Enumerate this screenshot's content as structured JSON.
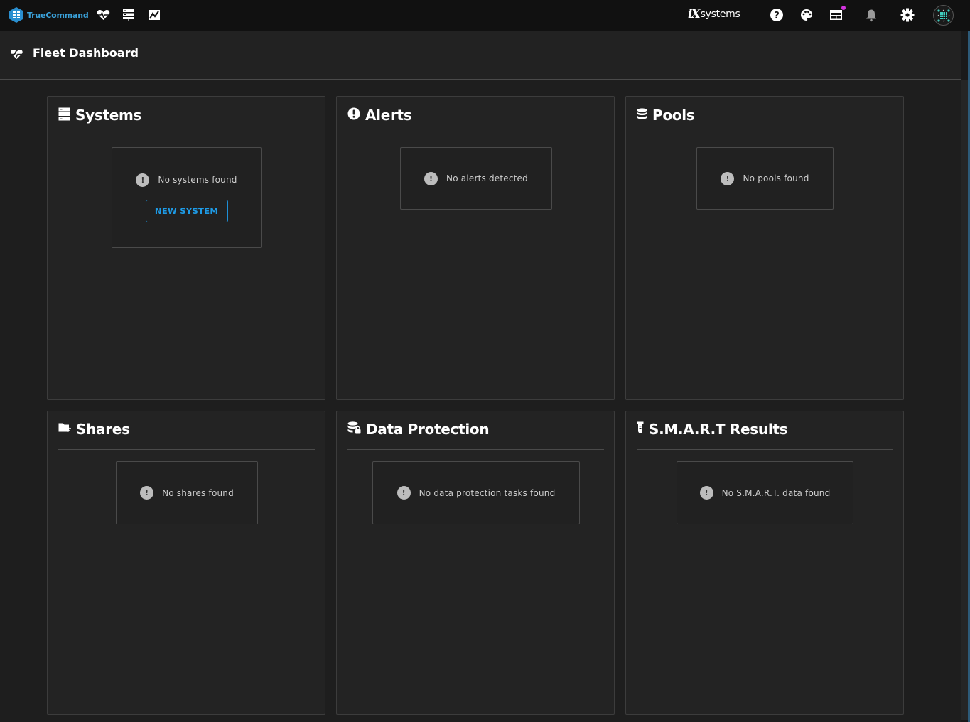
{
  "topbar": {
    "brand": "TrueCommand",
    "nav_icons": [
      "dashboard-heart-icon",
      "systems-server-icon",
      "reports-chart-icon"
    ],
    "vendor_logo": {
      "badge": "iX",
      "text": "systems"
    },
    "right_icons": [
      "help-icon",
      "theme-palette-icon",
      "news-calendar-icon",
      "notifications-bell-icon",
      "settings-gear-icon"
    ],
    "notification_dot_color": "#d533e0",
    "avatar_accent_color": "#3fd0c0"
  },
  "page": {
    "title": "Fleet Dashboard"
  },
  "cards": [
    {
      "id": "systems",
      "title": "Systems",
      "icon": "server-icon",
      "empty_text": "No systems found",
      "action_label": "NEW SYSTEM"
    },
    {
      "id": "alerts",
      "title": "Alerts",
      "icon": "alert-circle-icon",
      "empty_text": "No alerts detected"
    },
    {
      "id": "pools",
      "title": "Pools",
      "icon": "database-icon",
      "empty_text": "No pools found"
    },
    {
      "id": "shares",
      "title": "Shares",
      "icon": "folder-share-icon",
      "empty_text": "No shares found"
    },
    {
      "id": "data-protection",
      "title": "Data Protection",
      "icon": "database-lock-icon",
      "empty_text": "No data protection tasks found"
    },
    {
      "id": "smart",
      "title": "S.M.A.R.T Results",
      "icon": "test-tube-icon",
      "empty_text": "No S.M.A.R.T. data found"
    }
  ],
  "colors": {
    "accent": "#1e9be6",
    "brand": "#3aa0d8",
    "background": "#1e1e1e",
    "card": "#232323"
  },
  "warn_glyph": "!"
}
